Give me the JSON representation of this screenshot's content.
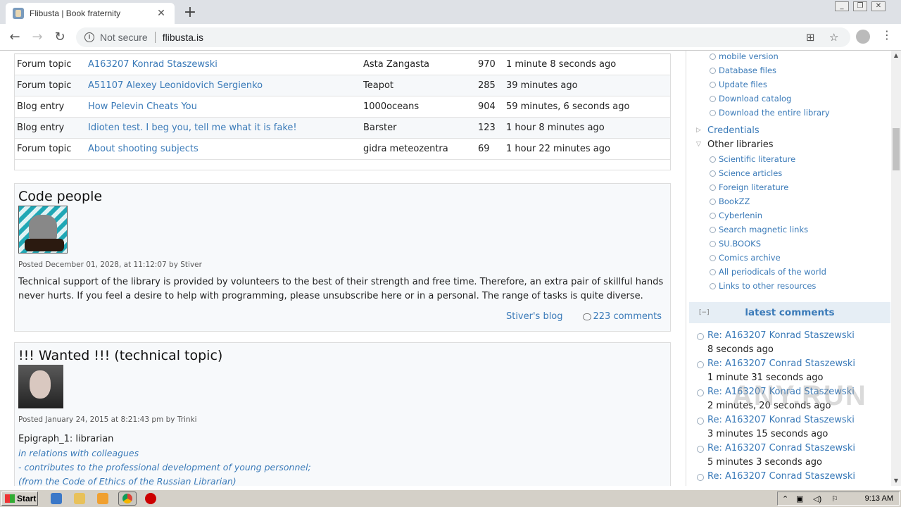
{
  "browser": {
    "tab_title": "Flibusta | Book fraternity",
    "tab_close": "✕",
    "new_tab": "+",
    "not_secure": "Not secure",
    "url": "flibusta.is"
  },
  "recent": {
    "rows": [
      {
        "type": "Forum topic",
        "title": "A163207 Konrad Staszewski",
        "author": "Asta Zangasta",
        "count": "970",
        "time": "1 minute 8 seconds ago"
      },
      {
        "type": "Forum topic",
        "title": "A51107 Alexey Leonidovich Sergienko",
        "author": "Teapot",
        "count": "285",
        "time": "39 minutes ago"
      },
      {
        "type": "Blog entry",
        "title": "How Pelevin Cheats You",
        "author": "1000oceans",
        "count": "904",
        "time": "59 minutes, 6 seconds ago"
      },
      {
        "type": "Blog entry",
        "title": "Idioten test. I beg you, tell me what it is fake!",
        "author": "Barster",
        "count": "123",
        "time": "1 hour 8 minutes ago"
      },
      {
        "type": "Forum topic",
        "title": "About shooting subjects",
        "author": "gidra meteozentra",
        "count": "69",
        "time": "1 hour 22 minutes ago"
      }
    ]
  },
  "post1": {
    "title": "Code people",
    "posted": "Posted December 01, 2028, at 11:12:07 by Stiver",
    "body": "Technical support of the library is provided by volunteers to the best of their strength and free time. Therefore, an extra pair of skillful hands never hurts. If you feel a desire to help with programming, please unsubscribe here or in a personal. The range of tasks is quite diverse.",
    "blog_link": "Stiver's blog",
    "comments_link": "223 comments"
  },
  "post2": {
    "title": "!!! Wanted !!! (technical topic)",
    "posted": "Posted January 24, 2015 at 8:21:43 pm by Trinki",
    "epigraph": "Epigraph_1: librarian",
    "lines": [
      "in relations with colleagues",
      "- contributes to the professional development of young personnel;",
      "(from the Code of Ethics of the Russian Librarian)"
    ]
  },
  "sidebar": {
    "top_items": [
      "mobile version",
      "Database files",
      "Update files",
      "Download catalog",
      "Download the entire library"
    ],
    "credentials": "Credentials",
    "other_libraries": "Other libraries",
    "other_items": [
      "Scientific literature",
      "Science articles",
      "Foreign literature",
      "BookZZ",
      "Cyberlenin",
      "Search magnetic links",
      "SU.BOOKS",
      "Comics archive",
      "All periodicals of the world",
      "Links to other resources"
    ],
    "latest_collapse": "[−]",
    "latest_title": "latest comments",
    "latest": [
      {
        "title": "Re: A163207 Konrad Staszewski",
        "time": "8 seconds ago"
      },
      {
        "title": "Re: A163207 Conrad Staszewski",
        "time": "1 minute 31 seconds ago"
      },
      {
        "title": "Re: A163207 Konrad Staszewski",
        "time": "2 minutes, 20 seconds ago"
      },
      {
        "title": "Re: A163207 Konrad Staszewski",
        "time": "3 minutes 15 seconds ago"
      },
      {
        "title": "Re: A163207 Conrad Staszewski",
        "time": "5 minutes 3 seconds ago"
      },
      {
        "title": "Re: A163207 Conrad Staszewski",
        "time": ""
      }
    ]
  },
  "taskbar": {
    "start": "Start",
    "clock": "9:13 AM"
  },
  "colors": {
    "link": "#3a7ab8",
    "sidebar_header": "#e6eef5"
  }
}
